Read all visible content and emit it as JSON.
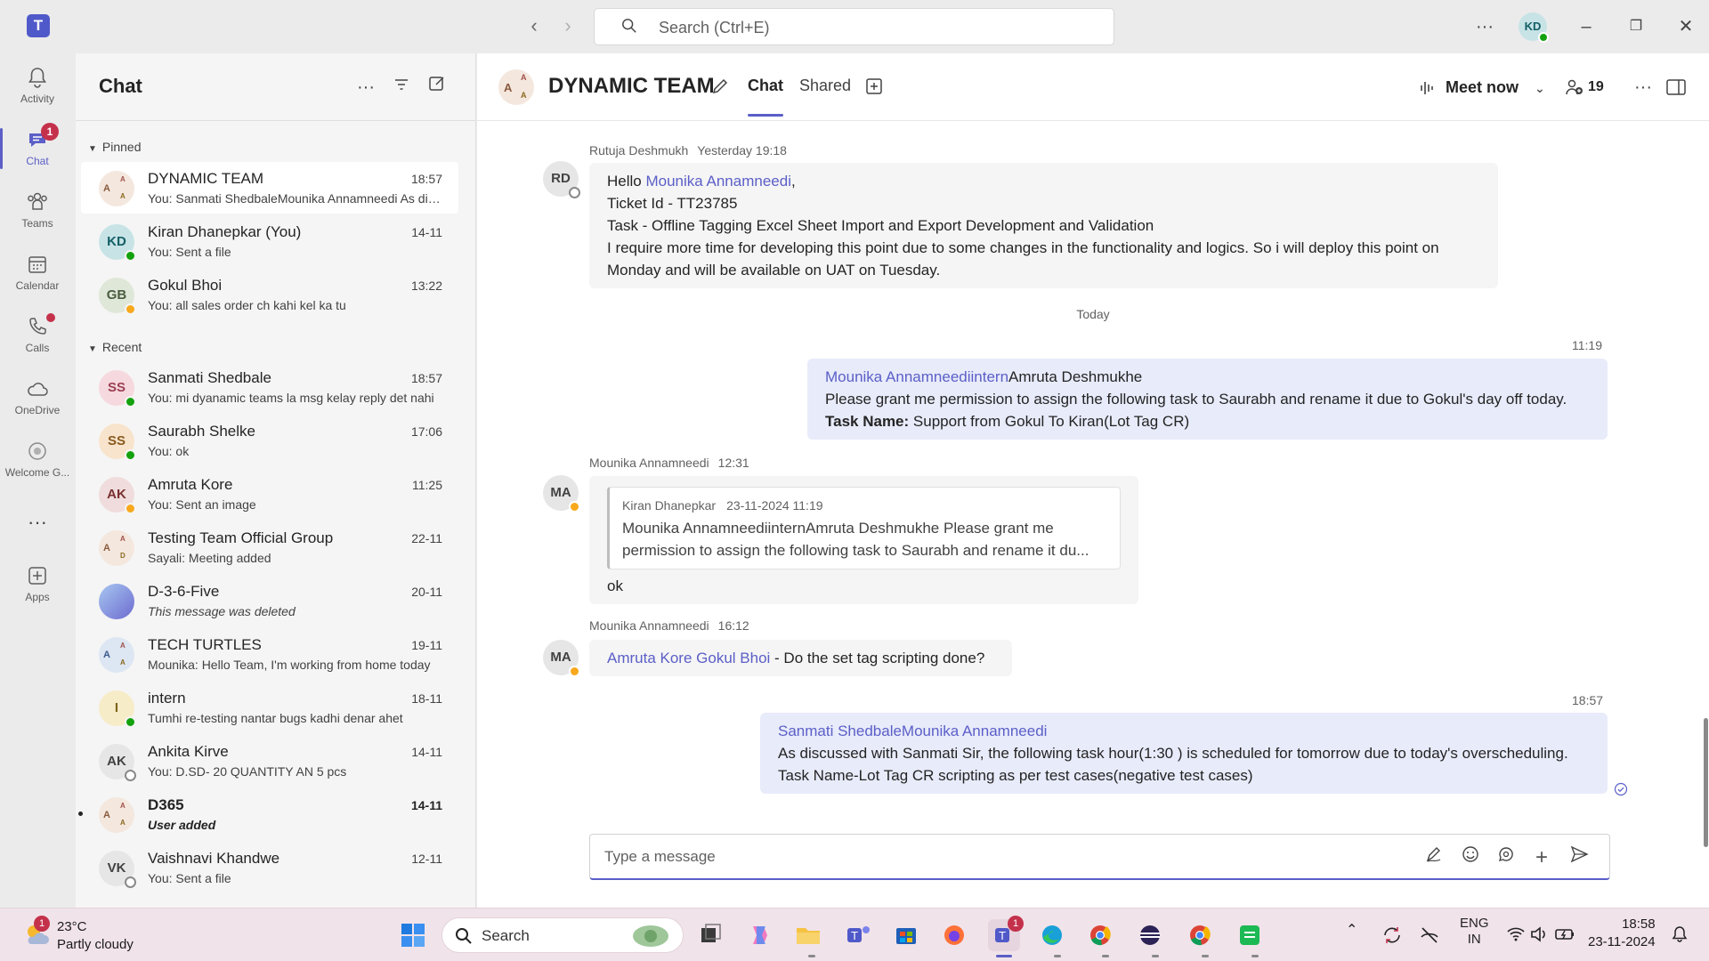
{
  "titlebar": {
    "app_name_glyph": "T",
    "search_placeholder": "Search (Ctrl+E)",
    "back_icon": "chevron-left-icon",
    "forward_icon": "chevron-right-icon",
    "more_icon": "more-horizontal-icon",
    "user_initials": "KD",
    "window_controls": [
      "minimize",
      "restore",
      "close"
    ]
  },
  "rail": {
    "items": [
      {
        "label": "Activity",
        "icon": "bell-icon"
      },
      {
        "label": "Chat",
        "icon": "chat-icon",
        "badge": "1",
        "active": true
      },
      {
        "label": "Teams",
        "icon": "teams-icon"
      },
      {
        "label": "Calendar",
        "icon": "calendar-icon"
      },
      {
        "label": "Calls",
        "icon": "phone-icon",
        "dot": true
      },
      {
        "label": "OneDrive",
        "icon": "cloud-icon"
      },
      {
        "label": "Welcome G...",
        "icon": "welcome-icon"
      },
      {
        "label": "",
        "icon": "more-horizontal-icon"
      },
      {
        "label": "Apps",
        "icon": "add-app-icon"
      }
    ]
  },
  "chatlist": {
    "title": "Chat",
    "sections": {
      "pinned": "Pinned",
      "recent": "Recent"
    },
    "pinned": [
      {
        "name": "DYNAMIC TEAM",
        "time": "18:57",
        "preview": "You: Sanmati ShedbaleMounika Annamneedi As discussed with Sanmati Sir",
        "type": "group",
        "initials": [
          "A",
          "A",
          "A"
        ],
        "selected": true
      },
      {
        "name": "Kiran Dhanepkar (You)",
        "time": "14-11",
        "preview": "You: Sent a file",
        "initials": "KD",
        "av_bg": "#c7e3e6",
        "av_fg": "#135f66",
        "status": "available"
      },
      {
        "name": "Gokul Bhoi",
        "time": "13:22",
        "preview": "You: all sales order ch kahi kel ka tu",
        "initials": "GB",
        "av_bg": "#dfe7d9",
        "av_fg": "#4a5d3e",
        "status": "away"
      }
    ],
    "recent": [
      {
        "name": "Sanmati Shedbale",
        "time": "18:57",
        "preview": "You: mi dyanamic teams la msg kelay reply det nahi",
        "initials": "SS",
        "av_bg": "#f6d9de",
        "av_fg": "#9a3f52",
        "status": "available"
      },
      {
        "name": "Saurabh Shelke",
        "time": "17:06",
        "preview": "You: ok",
        "initials": "SS",
        "av_bg": "#f8e4cc",
        "av_fg": "#8a5a1f",
        "status": "available"
      },
      {
        "name": "Amruta Kore",
        "time": "11:25",
        "preview": "You: Sent an image",
        "initials": "AK",
        "av_bg": "#f0dcdc",
        "av_fg": "#7a2f2f",
        "status": "away"
      },
      {
        "name": "Testing Team Official Group",
        "time": "22-11",
        "preview": "Sayali: Meeting added",
        "type": "group",
        "initials": [
          "A",
          "A",
          "D"
        ]
      },
      {
        "name": "D-3-6-Five",
        "time": "20-11",
        "preview": "This message was deleted",
        "type": "image",
        "italic": true
      },
      {
        "name": "TECH TURTLES",
        "time": "19-11",
        "preview": "Mounika: Hello Team, I'm working from home today",
        "type": "group",
        "initials": [
          "A",
          "A",
          "A"
        ],
        "group_bg": "#dde6f3"
      },
      {
        "name": "intern",
        "time": "18-11",
        "preview": "Tumhi re-testing nantar bugs kadhi denar ahet",
        "initials": "I",
        "av_bg": "#f7ecc8",
        "av_fg": "#7a6419",
        "status": "available"
      },
      {
        "name": "Ankita Kirve",
        "time": "14-11",
        "preview": "You: D.SD- 20  QUANTITY AN 5 pcs",
        "initials": "AK",
        "av_bg": "#e6e6e6",
        "av_fg": "#424242",
        "status": "offline"
      },
      {
        "name": "D365",
        "time": "14-11",
        "preview": "User added",
        "type": "group",
        "initials": [
          "A",
          "A",
          "A"
        ],
        "bold": true,
        "italic": true,
        "unread": true
      },
      {
        "name": "Vaishnavi Khandwe",
        "time": "12-11",
        "preview": "You: Sent a file",
        "initials": "VK",
        "av_bg": "#e6e6e6",
        "av_fg": "#424242",
        "status": "offline"
      }
    ]
  },
  "main": {
    "title": "DYNAMIC TEAM",
    "tabs": [
      {
        "label": "Chat",
        "active": true
      },
      {
        "label": "Shared"
      }
    ],
    "meet_now": "Meet now",
    "participant_count": "19",
    "messages": {
      "m1": {
        "sender": "Rutuja Deshmukh",
        "time": "Yesterday 19:18",
        "initials": "RD",
        "greeting": "Hello ",
        "mention": "Mounika Annamneedi",
        "greeting_end": ",",
        "lines": [
          "Ticket Id - TT23785",
          "Task - Offline Tagging Excel Sheet Import and Export Development and Validation",
          "I require more time for developing this point due to some changes in the functionality and logics. So i will deploy this point on Monday and will be available on UAT on Tuesday."
        ]
      },
      "day_divider": "Today",
      "m2": {
        "time": "11:19",
        "mention": "Mounika Annamneediintern",
        "mention_rest": "Amruta Deshmukhe",
        "line1": "Please grant me permission to assign the following task to Saurabh and rename it due to Gokul's day off today.",
        "task_label": "Task Name:",
        "task_value": " Support from Gokul To Kiran(Lot Tag CR)"
      },
      "m3": {
        "sender": "Mounika Annamneedi",
        "time": "12:31",
        "initials": "MA",
        "quote_sender": "Kiran Dhanepkar",
        "quote_time": "23-11-2024 11:19",
        "quote_text": "Mounika AnnamneediinternAmruta Deshmukhe Please grant me permission to assign the following task to Saurabh and rename it du...",
        "reply": "ok"
      },
      "m4": {
        "sender": "Mounika Annamneedi",
        "time": "16:12",
        "initials": "MA",
        "mention": "Amruta Kore Gokul Bhoi",
        "text": " - Do the set tag scripting done?"
      },
      "m5": {
        "time": "18:57",
        "mention": "Sanmati ShedbaleMounika Annamneedi",
        "line1": "As discussed with Sanmati Sir, the following task hour(1:30 ) is scheduled for tomorrow due to today's overscheduling.",
        "line2": "Task Name-Lot Tag CR scripting as per test cases(negative test cases)"
      }
    },
    "composer_placeholder": "Type a message"
  },
  "taskbar": {
    "weather_temp": "23°C",
    "weather_cond": "Partly cloudy",
    "weather_badge": "1",
    "search_label": "Search",
    "lang_top": "ENG",
    "lang_bottom": "IN",
    "time": "18:58",
    "date": "23-11-2024",
    "teams_badge": "1"
  },
  "colors": {
    "accent": "#5b5fc7",
    "bubble_out": "#e8ebfa",
    "bubble_in": "#f5f5f5",
    "available": "#13a10e",
    "away": "#f8a81c",
    "badge": "#c4314b"
  }
}
